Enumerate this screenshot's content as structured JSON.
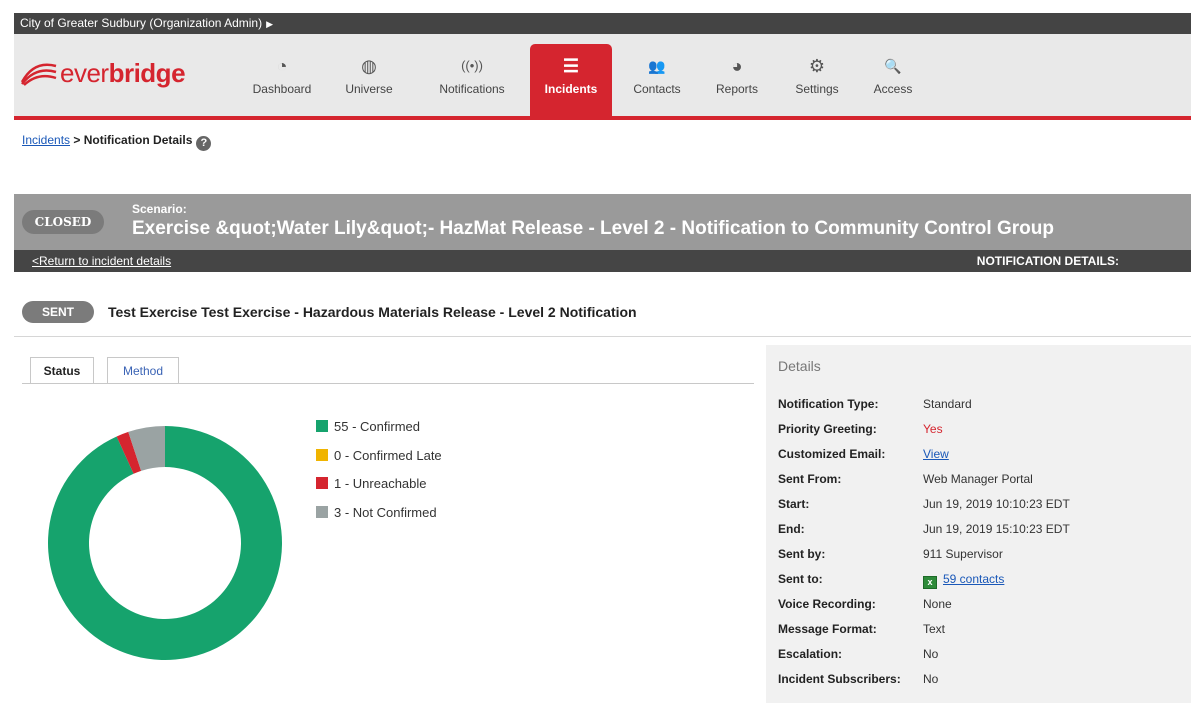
{
  "org_bar": {
    "label": "City of Greater Sudbury (Organization Admin)",
    "arrow": "▶"
  },
  "logo": {
    "text_light": "ever",
    "text_bold": "bridge"
  },
  "nav": [
    {
      "label": "Dashboard",
      "icon": "dashboard-icon",
      "glyph": "◔"
    },
    {
      "label": "Universe",
      "icon": "globe-icon",
      "glyph": "◍"
    },
    {
      "label": "Notifications",
      "icon": "broadcast-icon",
      "glyph": "((•))"
    },
    {
      "label": "Incidents",
      "icon": "list-icon",
      "glyph": "☰"
    },
    {
      "label": "Contacts",
      "icon": "people-icon",
      "glyph": "👥"
    },
    {
      "label": "Reports",
      "icon": "pie-chart-icon",
      "glyph": "◕"
    },
    {
      "label": "Settings",
      "icon": "gear-icon",
      "glyph": "⚙"
    },
    {
      "label": "Access",
      "icon": "key-icon",
      "glyph": "🔍"
    }
  ],
  "breadcrumb": {
    "link": "Incidents",
    "sep": " > ",
    "current": "Notification Details",
    "help": "?"
  },
  "banner": {
    "status": "CLOSED",
    "scenario_label": "Scenario:",
    "scenario_title": "Exercise &quot;Water Lily&quot;- HazMat Release - Level 2 - Notification to Community Control Group",
    "return_link": "<Return to incident details",
    "section_label": "NOTIFICATION DETAILS:"
  },
  "notification": {
    "status": "SENT",
    "title": "Test Exercise Test Exercise - Hazardous Materials Release - Level 2 Notification"
  },
  "tabs": [
    {
      "label": "Status"
    },
    {
      "label": "Method"
    }
  ],
  "colors": {
    "confirmed": "#16a36d",
    "late": "#f0b400",
    "unreachable": "#d5252f",
    "not_confirmed": "#9aa3a3",
    "brand": "#d5252f"
  },
  "chart_data": {
    "type": "pie",
    "values": [
      55,
      0,
      1,
      3
    ],
    "legend": [
      "55 - Confirmed",
      "0 - Confirmed Late",
      "1 - Unreachable",
      "3 - Not Confirmed"
    ]
  },
  "details": {
    "heading": "Details",
    "rows": [
      {
        "key": "Notification Type:",
        "value": "Standard"
      },
      {
        "key": "Priority Greeting:",
        "value": "Yes"
      },
      {
        "key": "Customized Email:",
        "value": "View"
      },
      {
        "key": "Sent From:",
        "value": "Web Manager Portal"
      },
      {
        "key": "Start:",
        "value": "Jun 19, 2019 10:10:23 EDT"
      },
      {
        "key": "End:",
        "value": "Jun 19, 2019 15:10:23 EDT"
      },
      {
        "key": "Sent by:",
        "value": "911 Supervisor"
      },
      {
        "key": "Sent to:",
        "value": "59 contacts"
      },
      {
        "key": "Voice Recording:",
        "value": "None"
      },
      {
        "key": "Message Format:",
        "value": "Text"
      },
      {
        "key": "Escalation:",
        "value": "No"
      },
      {
        "key": "Incident Subscribers:",
        "value": "No"
      }
    ]
  }
}
